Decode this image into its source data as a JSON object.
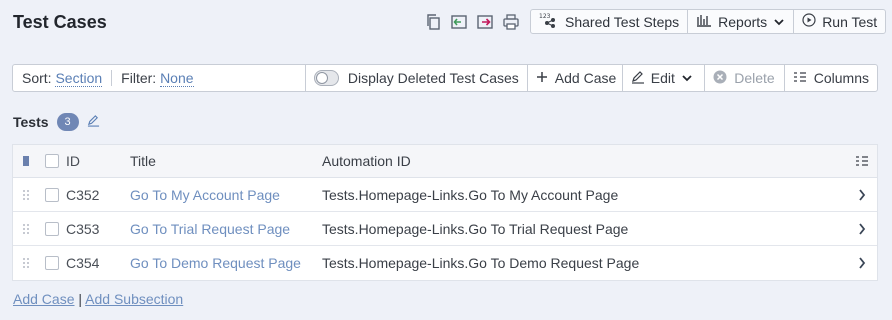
{
  "header": {
    "title": "Test Cases",
    "icons": [
      "copy-icon",
      "import-icon",
      "export-icon",
      "print-icon"
    ],
    "buttons": {
      "shared_steps": "Shared Test Steps",
      "reports": "Reports",
      "run_test": "Run Test"
    }
  },
  "toolbar": {
    "sort_label": "Sort:",
    "sort_value": "Section",
    "filter_label": "Filter:",
    "filter_value": "None",
    "toggle_label": "Display Deleted Test Cases",
    "add_case": "Add Case",
    "edit": "Edit",
    "delete": "Delete",
    "columns": "Columns"
  },
  "tests": {
    "label": "Tests",
    "count": "3"
  },
  "table": {
    "columns": {
      "id": "ID",
      "title": "Title",
      "automation": "Automation ID"
    },
    "rows": [
      {
        "id": "C352",
        "title": "Go To My Account Page",
        "automation": "Tests.Homepage-Links.Go To My Account Page"
      },
      {
        "id": "C353",
        "title": "Go To Trial Request Page",
        "automation": "Tests.Homepage-Links.Go To Trial Request Page"
      },
      {
        "id": "C354",
        "title": "Go To Demo Request Page",
        "automation": "Tests.Homepage-Links.Go To Demo Request Page"
      }
    ]
  },
  "footer": {
    "add_case": "Add Case",
    "separator": "|",
    "add_subsection": "Add Subsection"
  },
  "colors": {
    "background": "#eef1f8",
    "link": "#6f8fbf",
    "badge": "#7087b5"
  }
}
